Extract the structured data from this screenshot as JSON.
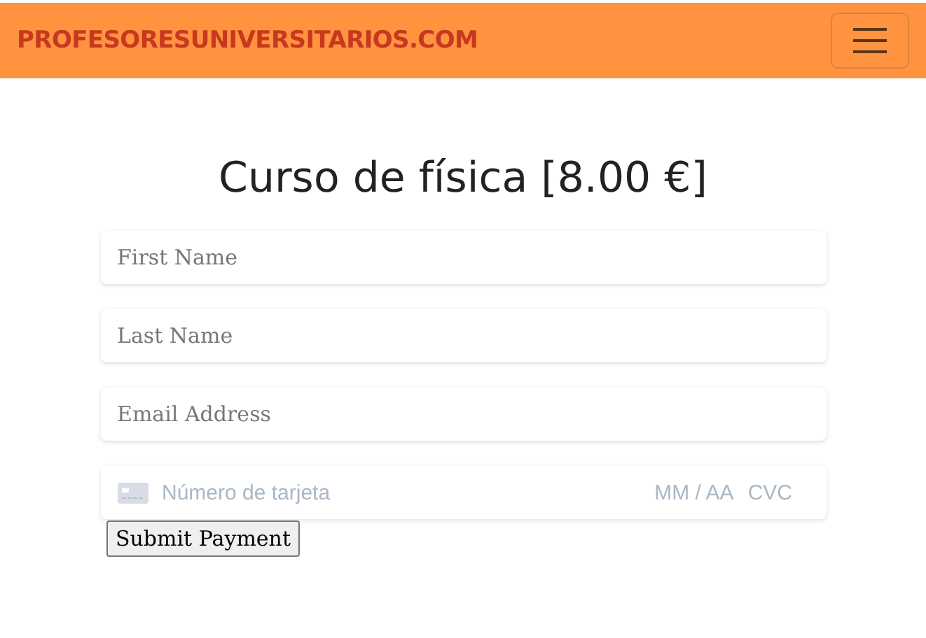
{
  "navbar": {
    "brand": "PROFESORESUNIVERSITARIOS.COM"
  },
  "title": "Curso de física [8.00 €]",
  "form": {
    "fields": [
      {
        "placeholder": "First Name"
      },
      {
        "placeholder": "Last Name"
      },
      {
        "placeholder": "Email Address"
      }
    ],
    "card": {
      "number_placeholder": "Número de tarjeta",
      "expiry_placeholder": "MM / AA",
      "cvc_placeholder": "CVC"
    },
    "submit": "Submit Payment"
  }
}
